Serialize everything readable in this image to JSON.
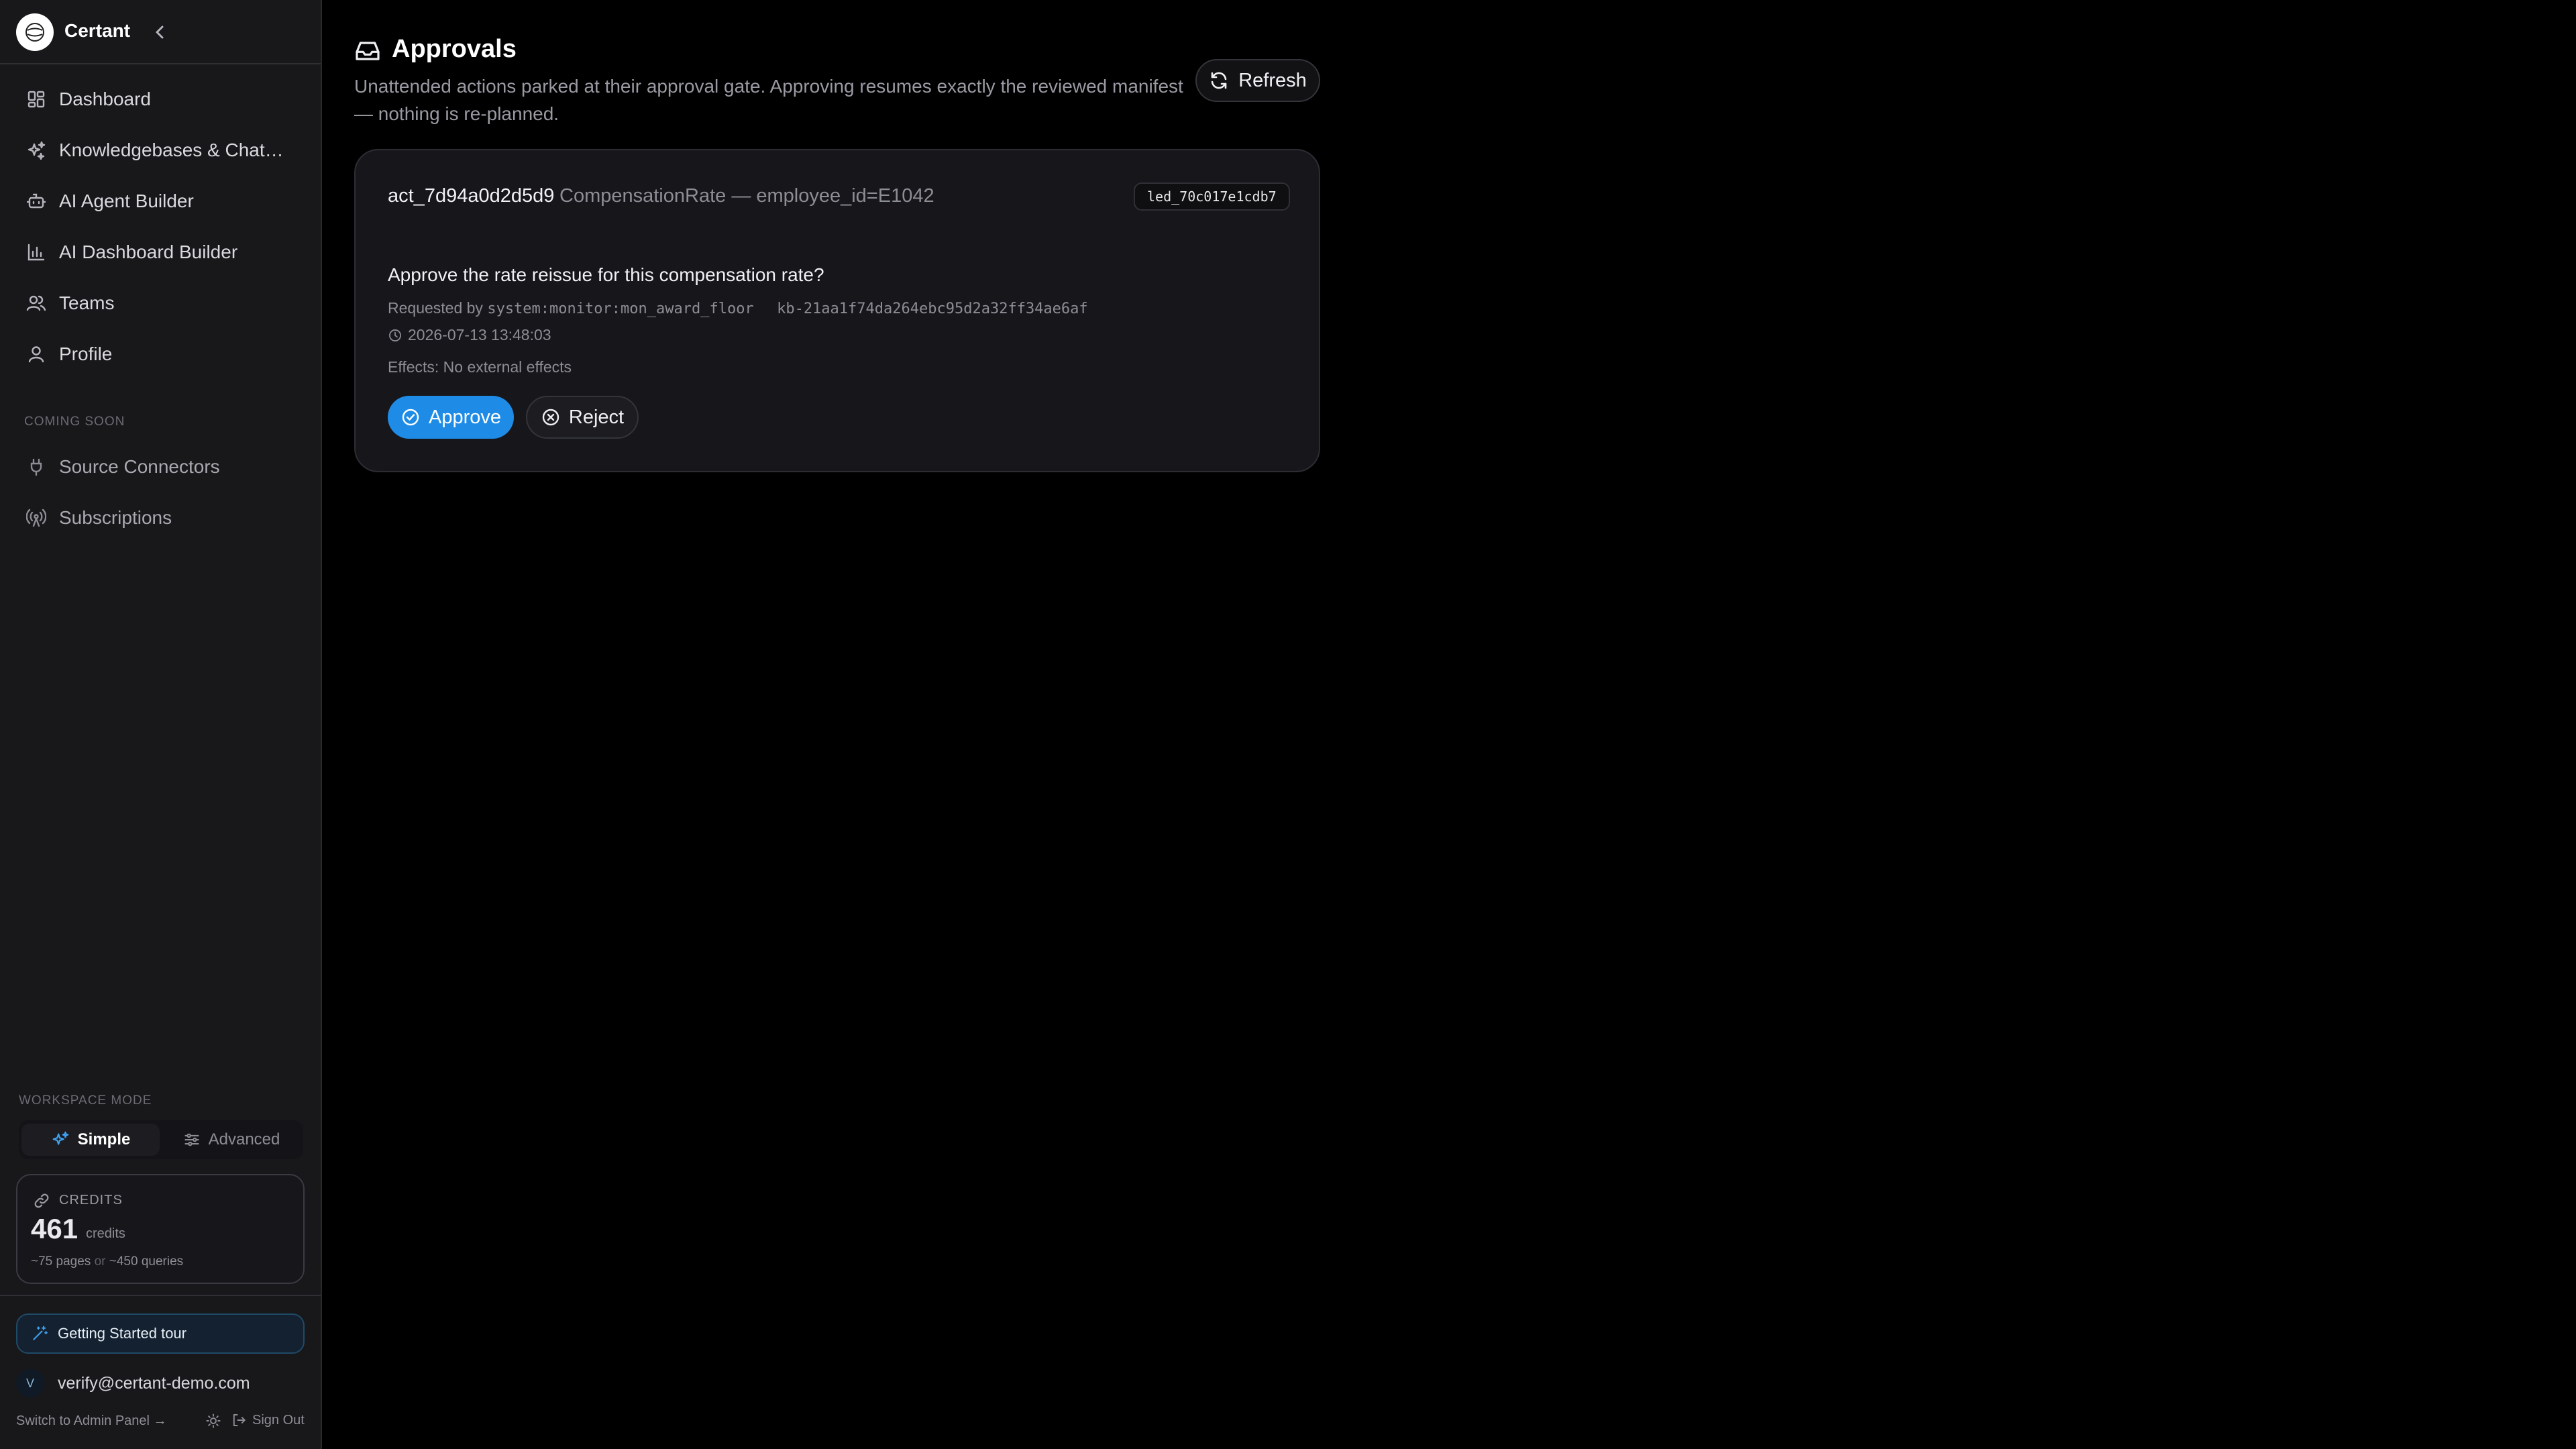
{
  "app": {
    "name": "Certant"
  },
  "sidebar": {
    "items": [
      {
        "label": "Dashboard",
        "icon": "dashboard-grid-icon"
      },
      {
        "label": "Knowledgebases & Chatb…",
        "icon": "sparkles-icon"
      },
      {
        "label": "AI Agent Builder",
        "icon": "bot-icon"
      },
      {
        "label": "AI Dashboard Builder",
        "icon": "bar-chart-icon"
      },
      {
        "label": "Teams",
        "icon": "users-icon"
      },
      {
        "label": "Profile",
        "icon": "user-icon"
      }
    ],
    "coming_soon_label": "COMING SOON",
    "coming_soon_items": [
      {
        "label": "Source Connectors",
        "icon": "plug-icon"
      },
      {
        "label": "Subscriptions",
        "icon": "broadcast-icon"
      }
    ],
    "workspace_mode": {
      "label": "WORKSPACE MODE",
      "options": [
        "Simple",
        "Advanced"
      ],
      "selected": "Simple"
    },
    "credits": {
      "title": "CREDITS",
      "amount": "461",
      "unit": "credits",
      "pages": "~75 pages",
      "or": "or",
      "queries": "~450 queries"
    },
    "tour_label": "Getting Started tour",
    "user": {
      "initial": "V",
      "email": "verify@certant-demo.com"
    },
    "switch_admin_label": "Switch to Admin Panel →",
    "sign_out_label": "Sign Out"
  },
  "main": {
    "title": "Approvals",
    "description": "Unattended actions parked at their approval gate. Approving resumes exactly the reviewed manifest — nothing is re-planned.",
    "refresh_label": "Refresh",
    "approval": {
      "action_id": "act_7d94a0d2d5d9",
      "entity": "CompensationRate — employee_id=E1042",
      "ledger_id": "led_70c017e1cdb7",
      "question": "Approve the rate reissue for this compensation rate?",
      "requested_by_label": "Requested by",
      "requested_by": "system:monitor:mon_award_floor",
      "kb_id": "kb-21aa1f74da264ebc95d2a32ff34ae6af",
      "timestamp": "2026-07-13 13:48:03",
      "effects": "Effects: No external effects",
      "approve_label": "Approve",
      "reject_label": "Reject"
    }
  },
  "colors": {
    "accent": "#1e8ce6",
    "background": "#000000",
    "sidebar": "#18181b"
  }
}
